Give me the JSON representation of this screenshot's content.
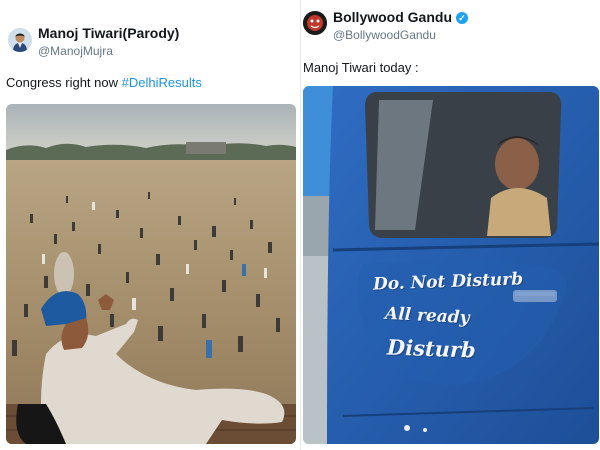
{
  "tweets": [
    {
      "display_name": "Manoj Tiwari(Parody)",
      "handle": "@ManojMujra",
      "text": "Congress right now ",
      "hashtag": "#DelhiResults",
      "avatar_icon": "man-portrait-icon",
      "image_icon": "cricket-ground-crowd-photo"
    },
    {
      "display_name": "Bollywood Gandu",
      "handle": "@BollywoodGandu",
      "verified": true,
      "verified_icon": "verified-badge-icon",
      "text": "Manoj Tiwari today :",
      "avatar_icon": "cartoon-face-icon",
      "image_icon": "blue-truck-photo",
      "image_text": {
        "line1": "Do. Not Disturb",
        "line2": "All ready",
        "line3": "Disturb"
      }
    }
  ],
  "colors": {
    "text": "#14171a",
    "secondary": "#657786",
    "link": "#1b95e0",
    "verified": "#1da1f2",
    "truck_blue": "#2563b8"
  }
}
